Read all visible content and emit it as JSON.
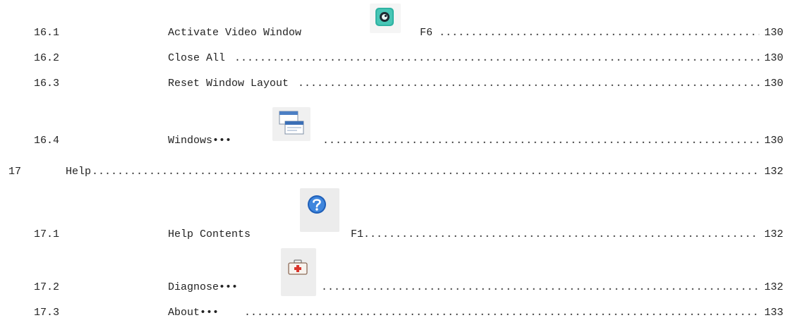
{
  "toc": {
    "entries": [
      {
        "id": "16-1",
        "number": "16.1",
        "title": "Activate Video Window",
        "shortcut": "F6",
        "page": "130",
        "icon": "video-window-icon"
      },
      {
        "id": "16-2",
        "number": "16.2",
        "title": "Close All",
        "shortcut": "",
        "page": "130",
        "icon": ""
      },
      {
        "id": "16-3",
        "number": "16.3",
        "title": "Reset Window Layout",
        "shortcut": "",
        "page": "130",
        "icon": ""
      },
      {
        "id": "16-4",
        "number": "16.4",
        "title": "Windows•••",
        "shortcut": "",
        "page": "130",
        "icon": "windows-stack-icon"
      },
      {
        "id": "17",
        "number": "17",
        "title": "Help",
        "shortcut": "",
        "page": "132",
        "icon": ""
      },
      {
        "id": "17-1",
        "number": "17.1",
        "title": "Help Contents",
        "shortcut": "F1",
        "page": "132",
        "icon": "help-question-icon"
      },
      {
        "id": "17-2",
        "number": "17.2",
        "title": "Diagnose•••",
        "shortcut": "",
        "page": "132",
        "icon": "first-aid-kit-icon"
      },
      {
        "id": "17-3",
        "number": "17.3",
        "title": "About•••",
        "shortcut": "",
        "page": "133",
        "icon": ""
      }
    ]
  }
}
